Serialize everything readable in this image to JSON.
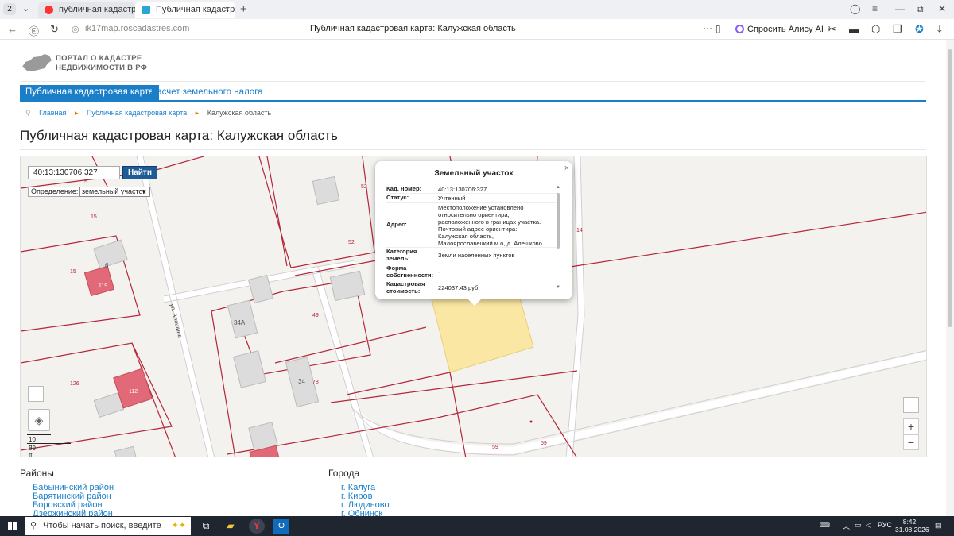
{
  "browser": {
    "tab_count": "2",
    "tabs": [
      {
        "label": "публичная кадастровая к"
      },
      {
        "label": "Публичная кадастровая"
      }
    ],
    "url": "ik17map.roscadastres.com",
    "page_title": "Публичная кадастровая карта: Калужская область",
    "alice_label": "Спросить Алису AI"
  },
  "site": {
    "logo_line1": "ПОРТАЛ О КАДАСТРЕ",
    "logo_line2": "НЕДВИЖИМОСТИ В РФ",
    "nav": [
      "Публичная кадастровая карта",
      "Расчет земельного налога"
    ],
    "breadcrumbs": [
      "Главная",
      "Публичная кадастровая карта",
      "Калужская область"
    ],
    "title": "Публичная кадастровая карта: Калужская область"
  },
  "map": {
    "search_value": "40:13:130706:327",
    "search_button": "Найти",
    "definition_label": "Определение:",
    "definition_value": "земельный участок",
    "scale_m": "10 m",
    "scale_ft": "50 ft",
    "zoom_in": "+",
    "zoom_out": "−",
    "labels": {
      "street": "ул. Алешина",
      "n52a": "52",
      "n52b": "52",
      "n14": "14",
      "n15a": "15",
      "n15b": "15",
      "n6": "6",
      "n119": "119",
      "n34a": "34А",
      "n49": "49",
      "n34": "34",
      "n78": "78",
      "n126": "126",
      "n112": "112",
      "n59a": "59",
      "n59b": "59",
      "n5": "5"
    }
  },
  "popup": {
    "title": "Земельный участок",
    "rows": [
      {
        "key": "Кад. номер:",
        "value": "40:13:130706:327"
      },
      {
        "key": "Статус:",
        "value": "Учтенный"
      },
      {
        "key": "Адрес:",
        "value": "Местоположение установлено относительно ориентира, расположенного в границах участка. Почтовый адрес ориентира: Калужская область, Малоярославецкий м.о, д. Алешково."
      },
      {
        "key": "Категория земель:",
        "value": "Земли населенных пунктов"
      },
      {
        "key": "Форма собственности:",
        "value": "-"
      },
      {
        "key": "Кадастровая стоимость:",
        "value": "224037.43 руб"
      }
    ]
  },
  "lists": {
    "districts_title": "Районы",
    "districts": [
      "Бабынинский район",
      "Барятинский район",
      "Боровский район",
      "Дзержинский район"
    ],
    "cities_title": "Города",
    "cities": [
      "г. Калуга",
      "г. Киров",
      "г. Людиново",
      "г. Обнинск"
    ]
  },
  "taskbar": {
    "search_placeholder": "Чтобы начать поиск, введите",
    "language": "РУС",
    "time": "8:42",
    "date": "31.08.2026"
  }
}
